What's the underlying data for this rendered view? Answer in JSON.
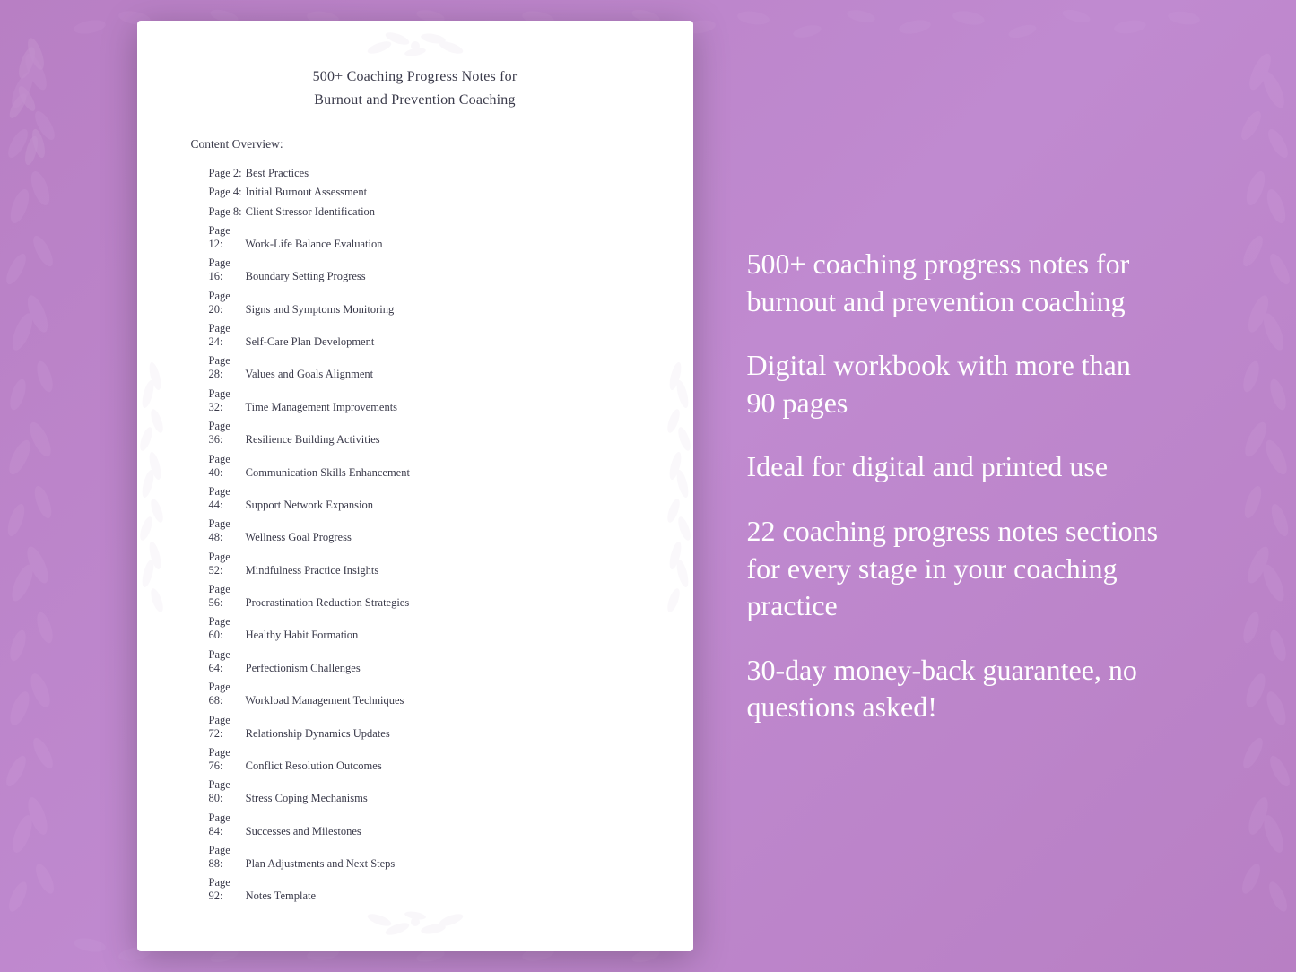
{
  "background": {
    "color": "#b87fc4"
  },
  "document": {
    "title_line1": "500+ Coaching Progress Notes for",
    "title_line2": "Burnout and Prevention Coaching",
    "content_overview_label": "Content Overview:",
    "toc_items": [
      {
        "page": "Page  2:",
        "title": "Best Practices"
      },
      {
        "page": "Page  4:",
        "title": "Initial Burnout Assessment"
      },
      {
        "page": "Page  8:",
        "title": "Client Stressor Identification"
      },
      {
        "page": "Page 12:",
        "title": "Work-Life Balance Evaluation"
      },
      {
        "page": "Page 16:",
        "title": "Boundary Setting Progress"
      },
      {
        "page": "Page 20:",
        "title": "Signs and Symptoms Monitoring"
      },
      {
        "page": "Page 24:",
        "title": "Self-Care Plan Development"
      },
      {
        "page": "Page 28:",
        "title": "Values and Goals Alignment"
      },
      {
        "page": "Page 32:",
        "title": "Time Management Improvements"
      },
      {
        "page": "Page 36:",
        "title": "Resilience Building Activities"
      },
      {
        "page": "Page 40:",
        "title": "Communication Skills Enhancement"
      },
      {
        "page": "Page 44:",
        "title": "Support Network Expansion"
      },
      {
        "page": "Page 48:",
        "title": "Wellness Goal Progress"
      },
      {
        "page": "Page 52:",
        "title": "Mindfulness Practice Insights"
      },
      {
        "page": "Page 56:",
        "title": "Procrastination Reduction Strategies"
      },
      {
        "page": "Page 60:",
        "title": "Healthy Habit Formation"
      },
      {
        "page": "Page 64:",
        "title": "Perfectionism Challenges"
      },
      {
        "page": "Page 68:",
        "title": "Workload Management Techniques"
      },
      {
        "page": "Page 72:",
        "title": "Relationship Dynamics Updates"
      },
      {
        "page": "Page 76:",
        "title": "Conflict Resolution Outcomes"
      },
      {
        "page": "Page 80:",
        "title": "Stress Coping Mechanisms"
      },
      {
        "page": "Page 84:",
        "title": "Successes and Milestones"
      },
      {
        "page": "Page 88:",
        "title": "Plan Adjustments and Next Steps"
      },
      {
        "page": "Page 92:",
        "title": "Notes Template"
      }
    ]
  },
  "features": [
    "500+ coaching progress notes for burnout and prevention coaching",
    "Digital workbook with more than 90 pages",
    "Ideal for digital and printed use",
    "22 coaching progress notes sections for every stage in your coaching practice",
    "30-day money-back guarantee, no questions asked!"
  ]
}
